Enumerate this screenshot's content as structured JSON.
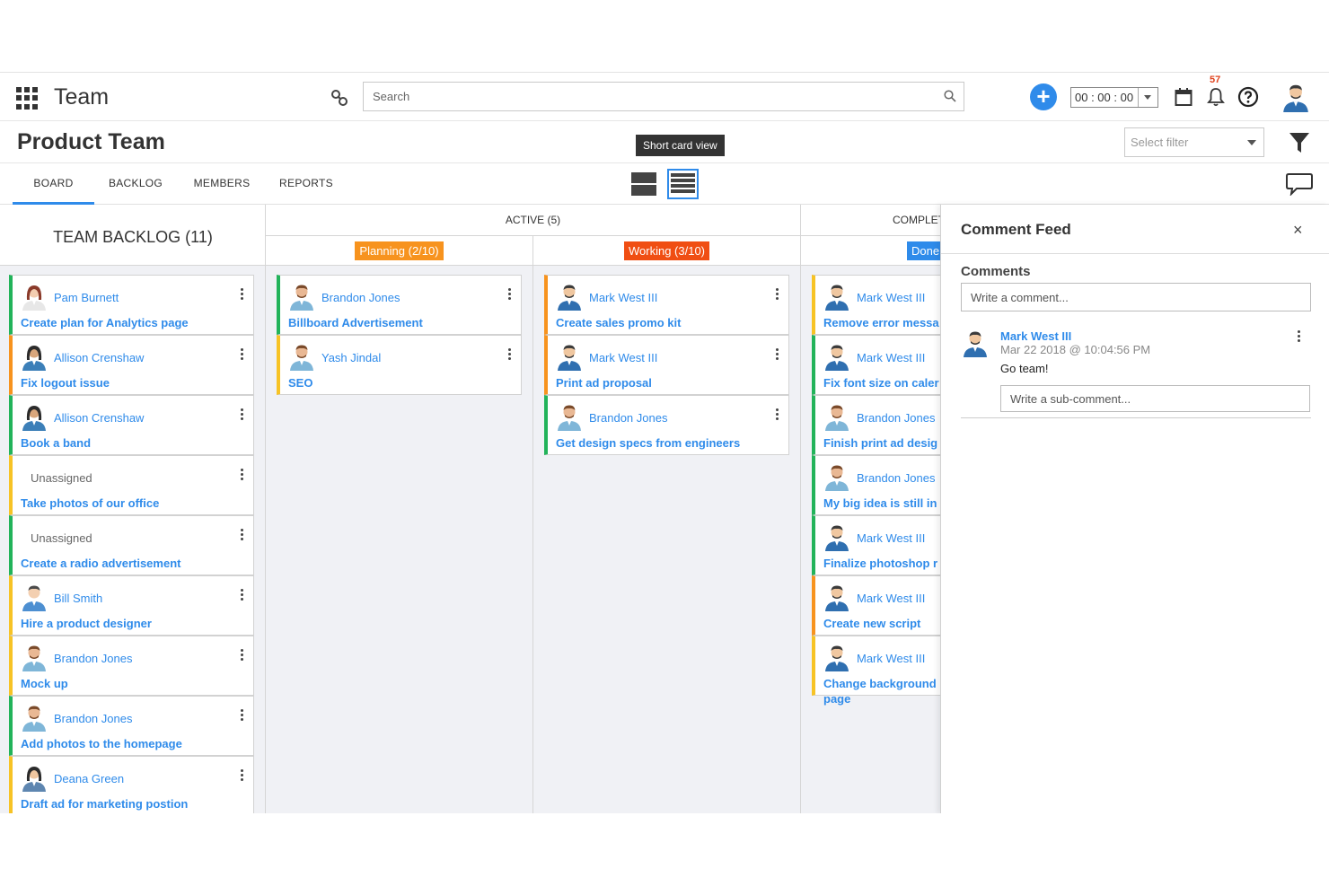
{
  "app": {
    "title": "Team"
  },
  "search": {
    "placeholder": "Search"
  },
  "timer": {
    "value": "00 : 00 : 00"
  },
  "notifications": {
    "count": "57"
  },
  "page": {
    "title": "Product Team",
    "tooltip": "Short card view",
    "filter_placeholder": "Select filter"
  },
  "tabs": [
    {
      "label": "BOARD",
      "active": true
    },
    {
      "label": "BACKLOG"
    },
    {
      "label": "MEMBERS"
    },
    {
      "label": "REPORTS"
    }
  ],
  "board": {
    "backlog": {
      "title": "TEAM BACKLOG (11)",
      "cards": [
        {
          "assignee": "Pam Burnett",
          "title": "Create plan for Analytics page",
          "color": "#22b35a",
          "avatar": "f1"
        },
        {
          "assignee": "Allison Crenshaw",
          "title": "Fix logout issue",
          "color": "#f7931e",
          "avatar": "f2"
        },
        {
          "assignee": "Allison Crenshaw",
          "title": "Book a band",
          "color": "#22b35a",
          "avatar": "f2"
        },
        {
          "assignee": "Unassigned",
          "title": "Take photos of our office",
          "color": "#f7c325",
          "avatar": ""
        },
        {
          "assignee": "Unassigned",
          "title": "Create a radio advertisement",
          "color": "#22b35a",
          "avatar": ""
        },
        {
          "assignee": "Bill Smith",
          "title": "Hire a product designer",
          "color": "#f7c325",
          "avatar": "m2"
        },
        {
          "assignee": "Brandon Jones",
          "title": "Mock up",
          "color": "#f7c325",
          "avatar": "m3"
        },
        {
          "assignee": "Brandon Jones",
          "title": "Add photos to the homepage",
          "color": "#22b35a",
          "avatar": "m3"
        },
        {
          "assignee": "Deana Green",
          "title": "Draft ad for marketing postion",
          "color": "#f7c325",
          "avatar": "f3"
        }
      ]
    },
    "active": {
      "title": "ACTIVE (5)",
      "planning": {
        "label": "Planning (2/10)",
        "color": "#f7931e",
        "cards": [
          {
            "assignee": "Brandon Jones",
            "title": "Billboard Advertisement",
            "color": "#22b35a",
            "avatar": "m3"
          },
          {
            "assignee": "Yash Jindal",
            "title": "SEO",
            "color": "#f7c325",
            "avatar": "m3"
          }
        ]
      },
      "working": {
        "label": "Working (3/10)",
        "color": "#f04e13",
        "cards": [
          {
            "assignee": "Mark West III",
            "title": "Create sales promo kit",
            "color": "#f7931e",
            "avatar": "m1"
          },
          {
            "assignee": "Mark West III",
            "title": "Print ad proposal",
            "color": "#f7931e",
            "avatar": "m1"
          },
          {
            "assignee": "Brandon Jones",
            "title": "Get design specs from engineers",
            "color": "#22b35a",
            "avatar": "m3"
          }
        ]
      }
    },
    "completed": {
      "title": "COMPLETE",
      "done": {
        "label": "Done",
        "color": "#2f8bea",
        "cards": [
          {
            "assignee": "Mark West III",
            "title": "Remove error messa",
            "color": "#f7c325",
            "avatar": "m1"
          },
          {
            "assignee": "Mark West III",
            "title": "Fix font size on caler",
            "color": "#22b35a",
            "avatar": "m1"
          },
          {
            "assignee": "Brandon Jones",
            "title": "Finish print ad desig",
            "color": "#22b35a",
            "avatar": "m3"
          },
          {
            "assignee": "Brandon Jones",
            "title": "My big idea is still in",
            "color": "#22b35a",
            "avatar": "m3"
          },
          {
            "assignee": "Mark West III",
            "title": "Finalize photoshop r",
            "color": "#22b35a",
            "avatar": "m1"
          },
          {
            "assignee": "Mark West III",
            "title": "Create new script",
            "color": "#f7931e",
            "avatar": "m1"
          },
          {
            "assignee": "Mark West III",
            "title": "Change background",
            "title2": "page",
            "color": "#f7c325",
            "avatar": "m1"
          }
        ]
      }
    }
  },
  "comment_feed": {
    "title": "Comment Feed",
    "close": "×",
    "comments_label": "Comments",
    "input_placeholder": "Write a comment...",
    "comments": [
      {
        "author": "Mark West III",
        "time": "Mar 22 2018 @ 10:04:56 PM",
        "text": "Go team!",
        "sub_placeholder": "Write a sub-comment..."
      }
    ]
  }
}
